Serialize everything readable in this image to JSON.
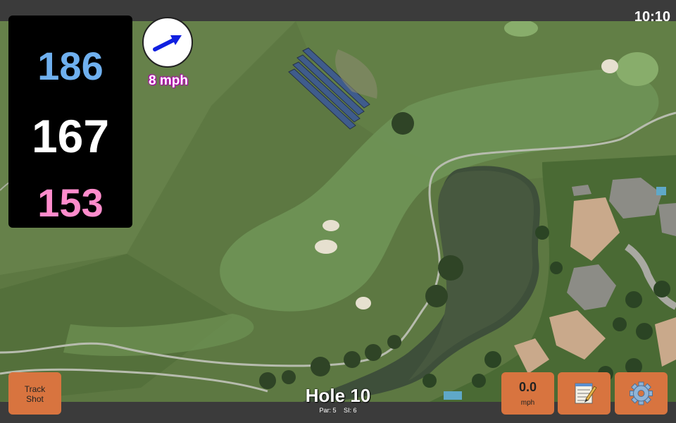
{
  "status": {
    "time": "10:10"
  },
  "distances": {
    "back": "186",
    "middle": "167",
    "front": "153"
  },
  "wind": {
    "speed_text": "8 mph",
    "direction_icon": "arrow-icon"
  },
  "hole": {
    "title": "Hole 10",
    "par_text": "Par: 5",
    "si_text": "SI: 6"
  },
  "buttons": {
    "track_shot_line1": "Track",
    "track_shot_line2": "Shot",
    "speed_value": "0.0",
    "speed_unit": "mph",
    "notes_icon": "notepad-icon",
    "settings_icon": "gear-icon"
  },
  "colors": {
    "back_distance": "#6fb0ef",
    "middle_distance": "#ffffff",
    "front_distance": "#ff8ccc",
    "button": "#d8743f",
    "wind_text_glow": "#c000c0"
  }
}
